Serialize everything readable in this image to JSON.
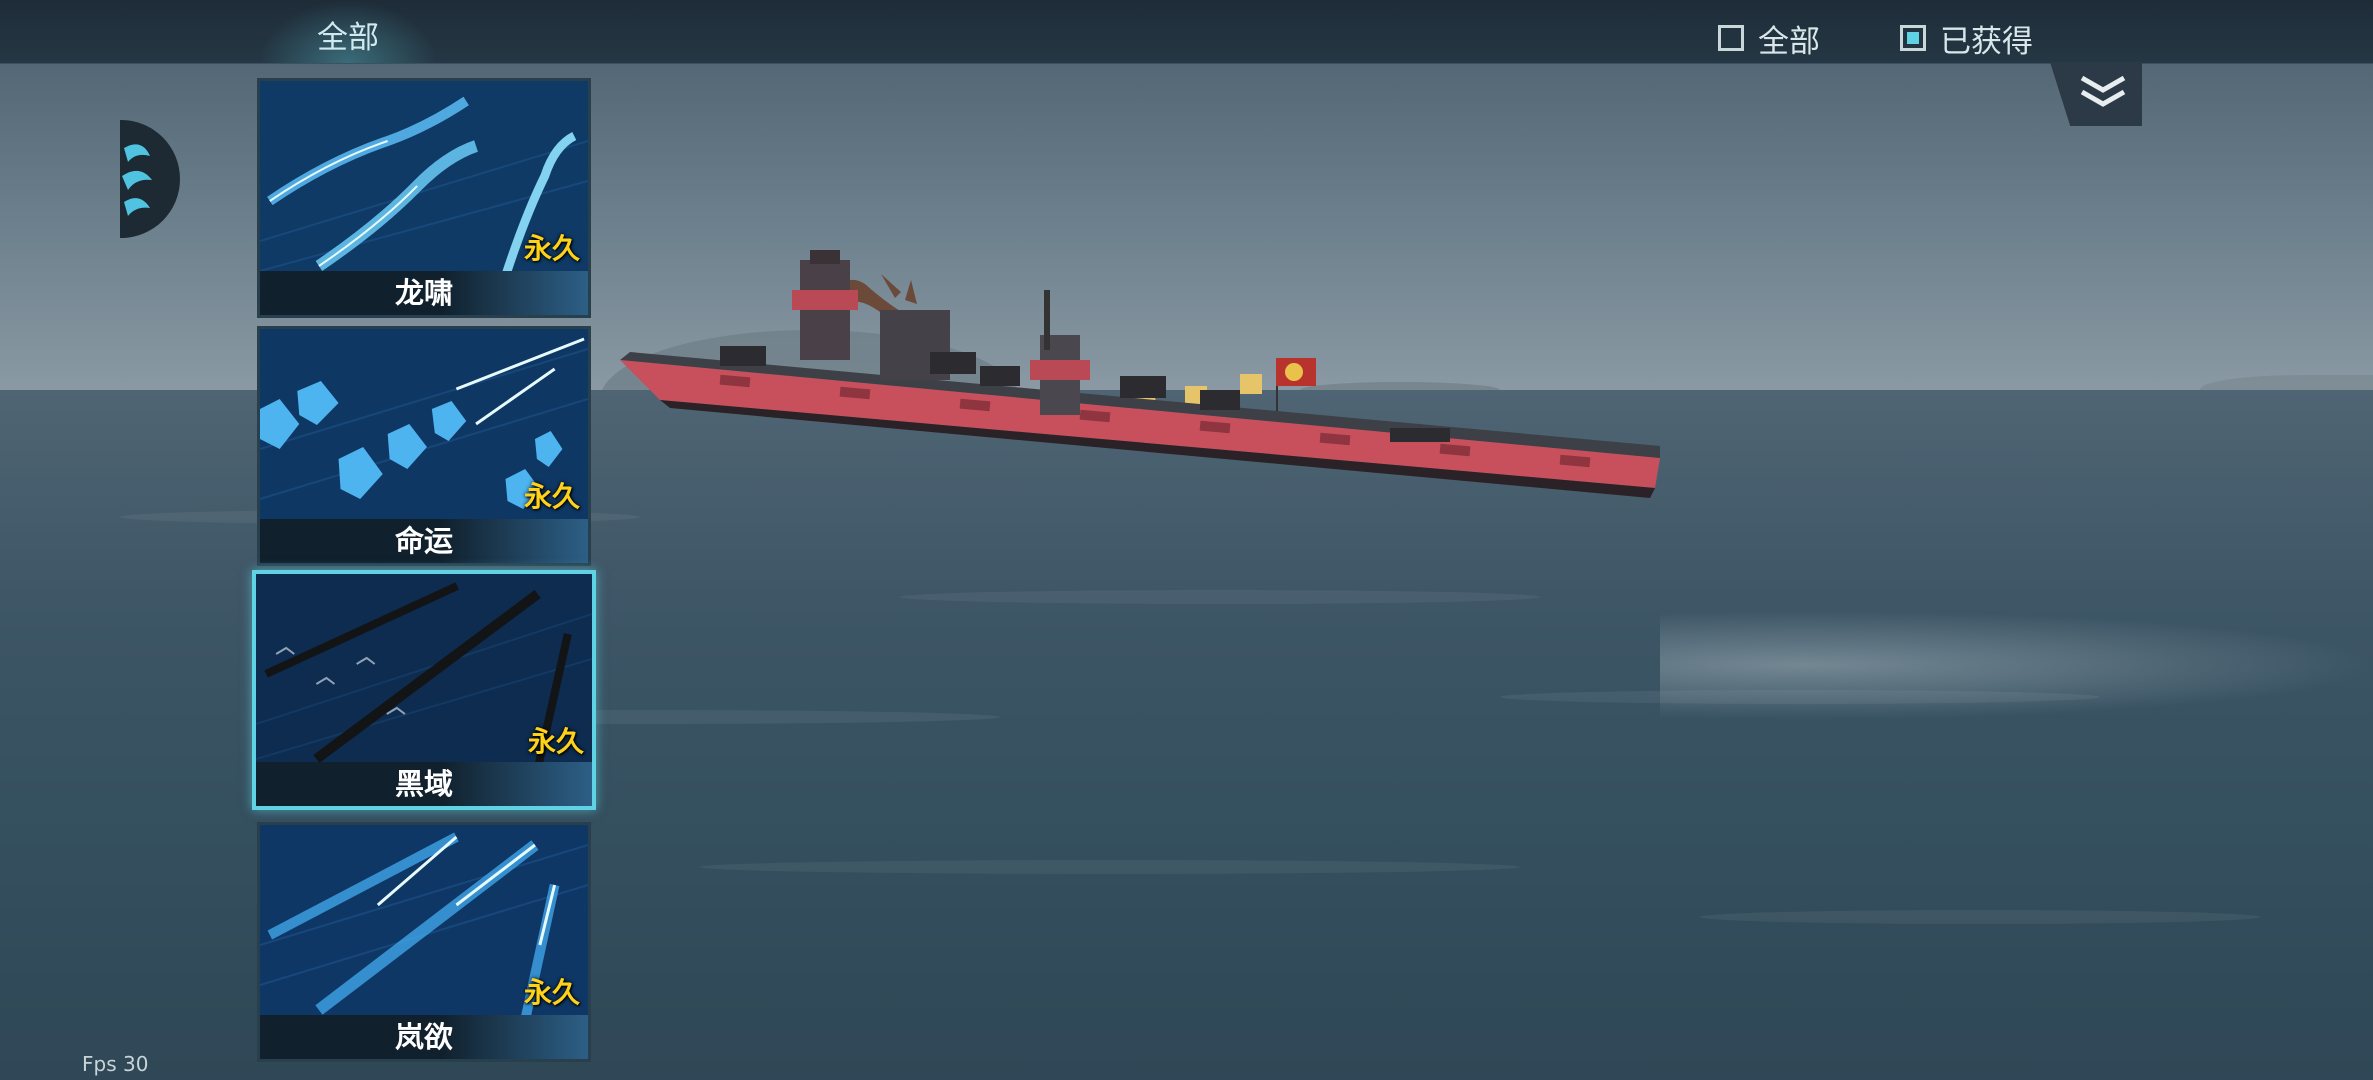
{
  "topbar": {
    "tab_all": "全部",
    "filter_all": "全部",
    "filter_obtained": "已获得"
  },
  "items": [
    {
      "name": "龙啸",
      "tag": "永久"
    },
    {
      "name": "命运",
      "tag": "永久"
    },
    {
      "name": "黑域",
      "tag": "永久"
    },
    {
      "name": "岚欲",
      "tag": "永久"
    }
  ],
  "fps_label": "Fps 30",
  "colors": {
    "accent": "#5fd3e4",
    "tag": "#ffd21a",
    "ship_hull": "#c8505c"
  }
}
